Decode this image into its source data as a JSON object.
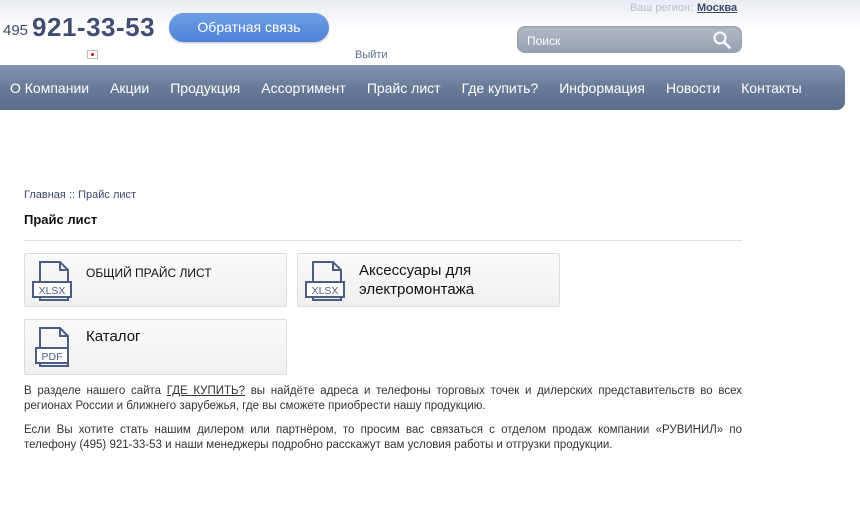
{
  "header": {
    "phone_prefix": "495",
    "phone_number": "921-33-53",
    "feedback_button": "Обратная связь",
    "logout_link": "Выйти",
    "region_label": "Ваш регион:",
    "region_city": "Москва",
    "search_placeholder": "Поиск"
  },
  "nav": {
    "items": [
      "О Компании",
      "Акции",
      "Продукция",
      "Ассортимент",
      "Прайс лист",
      "Где купить?",
      "Информация",
      "Новости",
      "Контакты"
    ]
  },
  "breadcrumb": {
    "home": "Главная",
    "separator": "::",
    "current": "Прайс лист"
  },
  "page": {
    "title": "Прайс лист"
  },
  "cards": [
    {
      "label": "ОБЩИЙ ПРАЙС ЛИСТ",
      "icon": "xlsx-file-icon",
      "badge": "XLSX"
    },
    {
      "label_line1": "Аксессуары для",
      "label_line2": "электромонтажа",
      "icon": "xlsx-file-icon",
      "badge": "XLSX"
    },
    {
      "label": "Каталог",
      "icon": "pdf-file-icon",
      "badge": "PDF"
    }
  ],
  "text": {
    "p1_before": "В разделе нашего сайта",
    "p1_link": "ГДЕ КУПИТЬ?",
    "p1_after": "вы найдёте  адреса и телефоны торговых точек и дилерских представительств во всех регионах России и ближнего зарубежья, где вы сможете приобрести  нашу продукцию.",
    "p2": "Если Вы хотите стать нашим дилером или партнёром, то просим вас связаться с отделом продаж компании «РУВИНИЛ» по телефону (495) 921-33-53 и наши менеджеры подробно расскажут вам условия работы и отгрузки продукции."
  },
  "colors": {
    "nav_bar": "#6a7b9a",
    "feedback_button": "#5b8ddc",
    "file_icon": "#4a5d85"
  }
}
